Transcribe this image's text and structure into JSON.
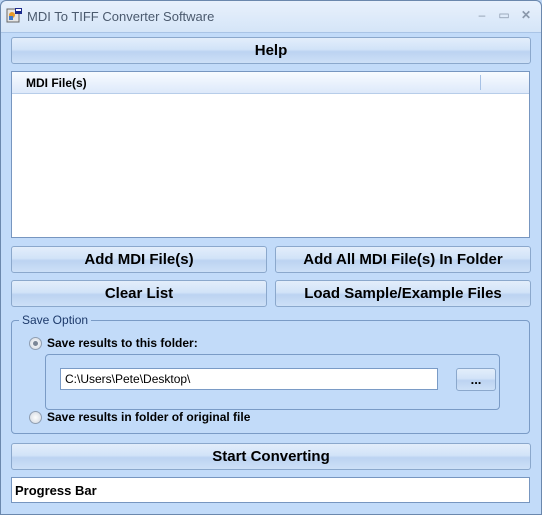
{
  "window": {
    "title": "MDI To TIFF Converter Software",
    "app_icon": "converter-app-icon",
    "controls": {
      "minimize": "–",
      "maximize": "▭",
      "close": "✕"
    }
  },
  "toolbar": {
    "help_label": "Help"
  },
  "file_list": {
    "columns": [
      "MDI File(s)"
    ],
    "rows": []
  },
  "actions": {
    "add_files": "Add MDI File(s)",
    "add_folder": "Add All MDI File(s) In Folder",
    "clear_list": "Clear List",
    "load_sample": "Load Sample/Example Files"
  },
  "save_option": {
    "group_label": "Save Option",
    "option_folder": "Save results to this folder:",
    "option_folder_selected": true,
    "folder_path": "C:\\Users\\Pete\\Desktop\\",
    "browse_label": "...",
    "option_original": "Save results in folder of original file",
    "option_original_selected": false
  },
  "convert": {
    "start_label": "Start Converting"
  },
  "progress": {
    "label": "Progress Bar"
  }
}
